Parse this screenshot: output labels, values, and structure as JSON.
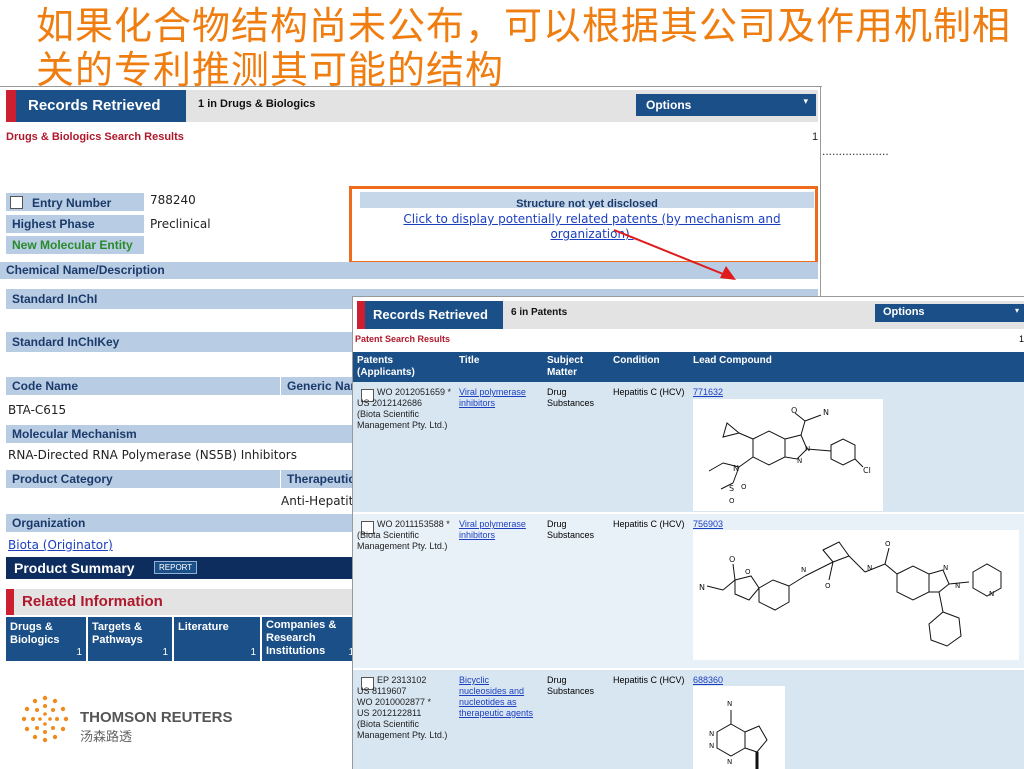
{
  "slide": {
    "title": "如果化合物结构尚未公布，可以根据其公司及作用机制相关的专利推测其可能的结构",
    "dotted_text": "....................",
    "brand_name": "THOMSON REUTERS",
    "brand_cn": "汤森路透"
  },
  "drugs_panel": {
    "header_title": "Records Retrieved",
    "header_count": "1",
    "header_db": "in Drugs & Biologics",
    "options_label": "Options",
    "results_title": "Drugs & Biologics Search Results",
    "results_count": "1",
    "entry_number_label": "Entry Number",
    "entry_number_value": "788240",
    "highest_phase_label": "Highest Phase",
    "highest_phase_value": "Preclinical",
    "nme_label": "New Molecular Entity",
    "structure_msg": "Structure not yet disclosed",
    "structure_link": "Click to display potentially related patents (by mechanism and organization).",
    "chem_name_label": "Chemical Name/Description",
    "inchi_label": "Standard InChI",
    "inchikey_label": "Standard InChIKey",
    "code_name_label": "Code Name",
    "generic_name_label": "Generic Nam",
    "code_name_value": "BTA-C615",
    "mechanism_label": "Molecular Mechanism",
    "mechanism_value": "RNA-Directed RNA Polymerase (NS5B) Inhibitors",
    "product_category_label": "Product Category",
    "therapeutic_label": "Therapeutic",
    "therapeutic_value": "Anti-Hepatiti",
    "organization_label": "Organization",
    "organization_value": "Biota (Originator)",
    "product_summary_label": "Product Summary",
    "report_label": "REPORT",
    "related_info_label": "Related Information",
    "tabs": [
      {
        "label": "Drugs & Biologics",
        "count": "1"
      },
      {
        "label": "Targets & Pathways",
        "count": "1"
      },
      {
        "label": "Literature",
        "count": "1"
      },
      {
        "label": "Companies & Research Institutions",
        "count": "1"
      }
    ]
  },
  "patents_panel": {
    "header_title": "Records Retrieved",
    "header_count": "6",
    "header_db": "in Patents",
    "options_label": "Options",
    "results_title": "Patent Search Results",
    "results_count": "1",
    "columns": [
      "Patents (Applicants)",
      "Title",
      "Subject Matter",
      "Condition",
      "Lead Compound"
    ],
    "rows": [
      {
        "patents": "WO 201205165​9 *\nUS 2012142686\n(Biota Scientific Management Pty. Ltd.)",
        "title": "Viral polymerase inhibitors",
        "subject": "Drug Substances",
        "condition": "Hepatitis C (HCV)",
        "compound": "771632"
      },
      {
        "patents": "WO 2011153588 *\n(Biota Scientific Management Pty. Ltd.)",
        "title": "Viral polymerase inhibitors",
        "subject": "Drug Substances",
        "condition": "Hepatitis C (HCV)",
        "compound": "756903"
      },
      {
        "patents": "EP 2313102\nUS 8119607\nWO 2010002877 *\nUS 2012122811\n(Biota Scientific Management Pty. Ltd.)",
        "title": "Bicyclic nucleosides and nucleotides as therapeutic agents",
        "subject": "Drug Substances",
        "condition": "Hepatitis C (HCV)",
        "compound": "688360"
      }
    ]
  }
}
